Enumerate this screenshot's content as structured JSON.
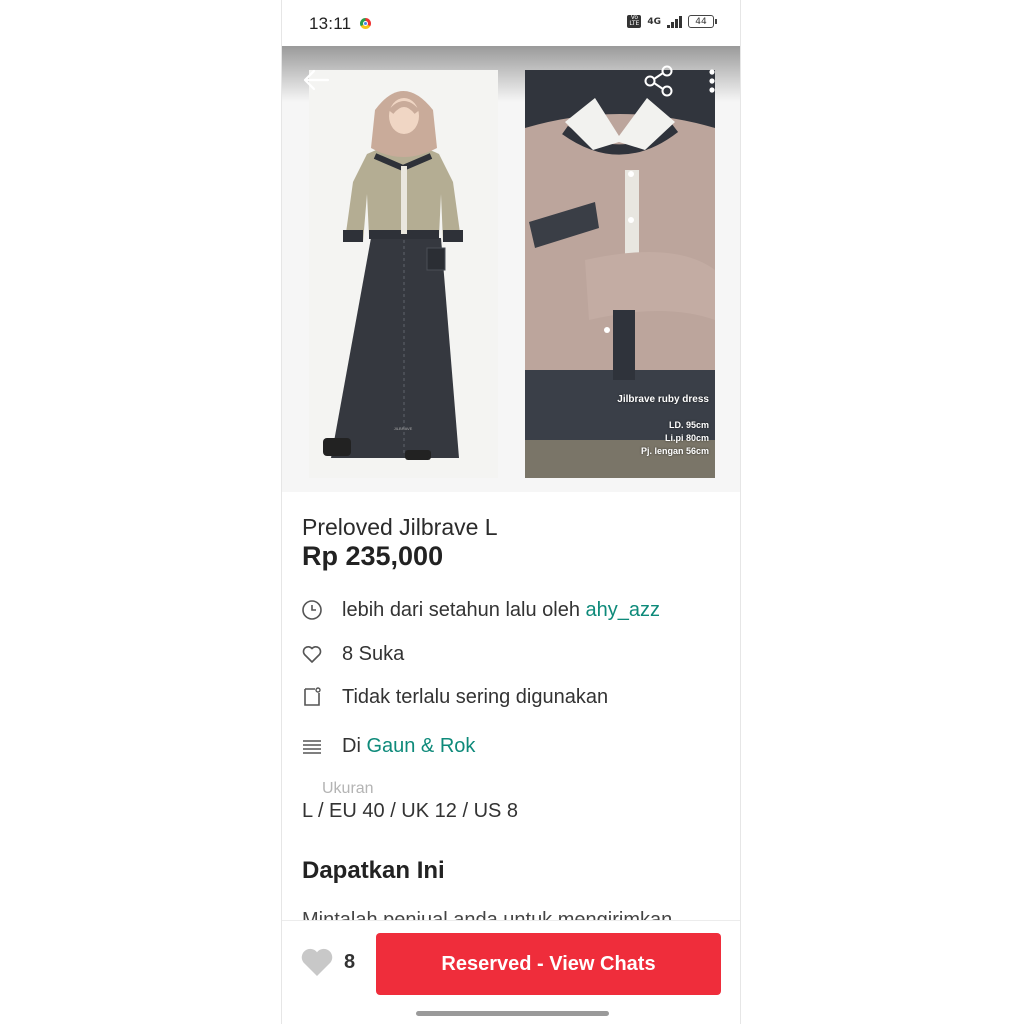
{
  "status_bar": {
    "time": "13:11",
    "network": "4G",
    "volte_badge": "Vo LTE",
    "battery": "44"
  },
  "gallery": {
    "photo2_caption": "Jilbrave ruby dress",
    "measurements": [
      "LD. 95cm",
      "Li.pi 80cm",
      "Pj. lengan 56cm"
    ],
    "icons": {
      "back": "arrow-left-icon",
      "share": "share-icon",
      "more": "more-vertical-icon"
    }
  },
  "product": {
    "title": "Preloved Jilbrave L",
    "price": "Rp 235,000"
  },
  "info": {
    "posted_prefix": "lebih dari setahun lalu oleh ",
    "seller": "ahy_azz",
    "likes": "8 Suka",
    "condition": "Tidak terlalu sering digunakan",
    "category_prefix": "Di ",
    "category": "Gaun & Rok"
  },
  "size": {
    "label": "Ukuran",
    "value": "L / EU 40 / UK 12 / US 8"
  },
  "section": {
    "title": "Dapatkan Ini",
    "description_partial": "Mintalah penjual anda untuk mengirimkan"
  },
  "bottom_bar": {
    "like_count": "8",
    "cta_label": "Reserved - View Chats"
  },
  "colors": {
    "accent_teal": "#0e8a7a",
    "cta_red": "#ef2d3b"
  }
}
